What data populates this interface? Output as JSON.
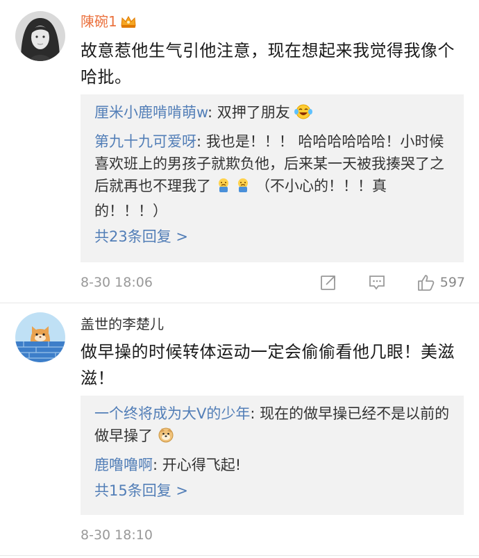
{
  "comments": [
    {
      "username": "陳碗1",
      "text": "故意惹他生气引他注意，现在想起来我觉得我像个哈批。",
      "replies": [
        {
          "name": "厘米小鹿啃啃萌w",
          "text": ": 双押了朋友"
        },
        {
          "name": "第九十九可爱呀",
          "text": ": 我也是！！！ 哈哈哈哈哈哈！小时候喜欢班上的男孩子就欺负他，后来某一天被我揍哭了之后就再也不理我了",
          "tail": "（不小心的！！！真的！！！）"
        }
      ],
      "more_replies": "共23条回复 >",
      "time": "8-30 18:06",
      "likes": "597"
    },
    {
      "username": "盖世的李楚儿",
      "text": "做早操的时候转体运动一定会偷偷看他几眼！美滋滋！",
      "replies": [
        {
          "name": "一个终将成为大V的少年",
          "text": ": 现在的做早操已经不是以前的做早操了"
        },
        {
          "name": "鹿噜噜啊",
          "text": ": 开心得飞起!"
        }
      ],
      "more_replies": "共15条回复 >",
      "time": "8-30 18:10"
    }
  ],
  "icons": {
    "crown": "vip-crown-icon",
    "repost": "repost-icon",
    "reply": "comment-icon",
    "like": "thumbs-up-icon"
  },
  "colors": {
    "vip_name": "#eb7340",
    "link": "#527eb7",
    "reply_bg": "#f2f2f2"
  }
}
